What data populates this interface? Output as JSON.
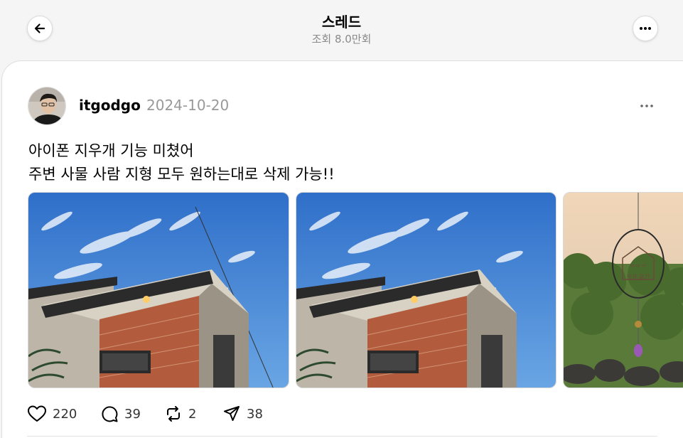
{
  "header": {
    "title": "스레드",
    "views": "조회 8.0만회"
  },
  "post": {
    "username": "itgodgo",
    "date": "2024-10-20",
    "text_line1": "아이폰 지우개 기능 미쳤어",
    "text_line2": "주변 사물 사람 지형 모두 원하는대로 삭제 가능!!",
    "images": [
      {
        "subject": "brick-house-before"
      },
      {
        "subject": "brick-house-after"
      },
      {
        "subject": "sign-ornament"
      }
    ],
    "sign_text": "또또공간"
  },
  "actions": {
    "likes": "220",
    "replies": "39",
    "reposts": "2",
    "shares": "38"
  },
  "colors": {
    "background": "#f5f5f5",
    "card": "#ffffff",
    "muted_text": "#999999",
    "sky": "#3f7fd2"
  }
}
